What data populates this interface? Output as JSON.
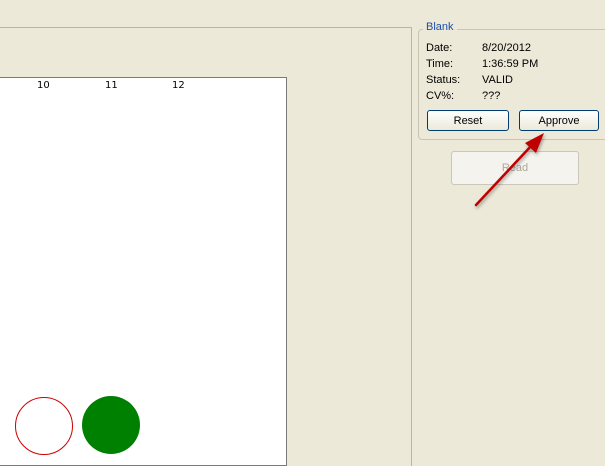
{
  "plate": {
    "column_labels": [
      "10",
      "11",
      "12"
    ]
  },
  "blank_group": {
    "title": "Blank",
    "fields": [
      {
        "label": "Date:",
        "value": "8/20/2012"
      },
      {
        "label": "Time:",
        "value": "1:36:59 PM"
      },
      {
        "label": "Status:",
        "value": "VALID"
      },
      {
        "label": "CV%:",
        "value": "???"
      }
    ],
    "reset_label": "Reset",
    "approve_label": "Approve"
  },
  "read_label": "Read",
  "colors": {
    "accent_title": "#1c4ea8",
    "filled_well": "#008000",
    "empty_well_border": "#cc0000",
    "annotation_arrow": "#c00000"
  }
}
